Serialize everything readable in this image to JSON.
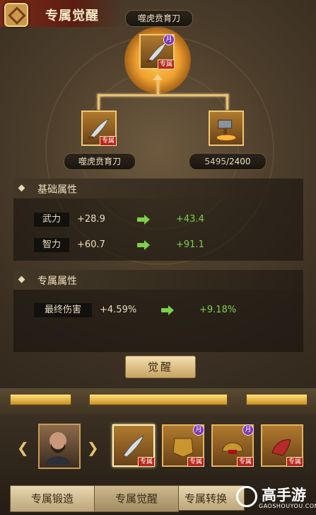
{
  "header": {
    "title": "专属觉醒"
  },
  "target_item": {
    "name": "噬虎贲育刀",
    "badge": "专属",
    "level_mark": "月"
  },
  "material_weapon": {
    "name": "噬虎贲育刀",
    "badge": "专属"
  },
  "material_ore": {
    "count_have": "5495",
    "count_need": "/2400"
  },
  "base_attributes": {
    "title": "基础属性",
    "rows": [
      {
        "label": "武力",
        "current": "+28.9",
        "next": "+43.4"
      },
      {
        "label": "智力",
        "current": "+60.7",
        "next": "+91.1"
      }
    ]
  },
  "exclusive_attributes": {
    "title": "专属属性",
    "rows": [
      {
        "label": "最终伤害",
        "current": "+4.59%",
        "next": "+9.18%"
      }
    ]
  },
  "awaken_button": {
    "label": "觉醒"
  },
  "equipment_cards": [
    {
      "badge": "专属",
      "mark": ""
    },
    {
      "badge": "专属",
      "mark": "月"
    },
    {
      "badge": "专属",
      "mark": "月"
    },
    {
      "badge": "专属",
      "mark": ""
    }
  ],
  "tabs": [
    "专属锻造",
    "专属觉醒",
    "专属转换"
  ],
  "watermark": {
    "brand": "高手游",
    "url": "GAOSHOUYOU.COM"
  },
  "colors": {
    "accent": "#e8c070",
    "increase": "#7cd04a",
    "badge": "#b6281c"
  }
}
